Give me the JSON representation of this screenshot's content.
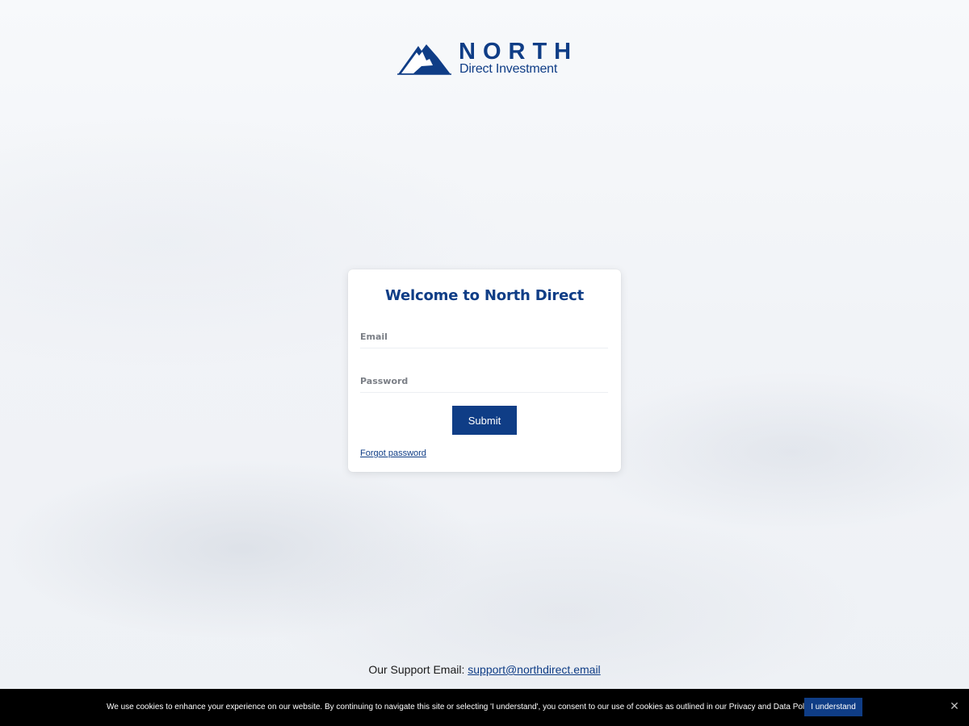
{
  "brand": {
    "name": "NORTH",
    "subtitle": "Direct Investment",
    "color": "#0f3d86"
  },
  "login": {
    "title": "Welcome to North Direct",
    "email_placeholder": "Email",
    "password_placeholder": "Password",
    "submit_label": "Submit",
    "forgot_label": "Forgot password"
  },
  "support": {
    "label": "Our Support Email:",
    "email": "support@northdirect.email"
  },
  "cookie_banner": {
    "text": "We use cookies to enhance your experience on our website. By continuing to navigate this site or selecting 'I understand', you consent to our use of cookies as outlined in our Privacy and Data Policy.",
    "accept_label": "I understand",
    "close_icon": "close-icon"
  }
}
